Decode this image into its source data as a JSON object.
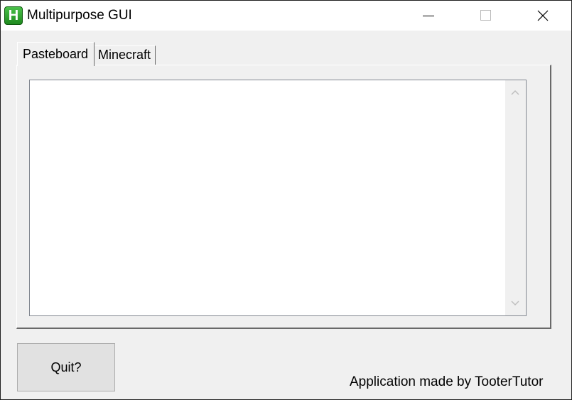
{
  "window": {
    "title": "Multipurpose GUI",
    "icon_letter": "H",
    "icon_color": "#2ca02c",
    "controls": [
      "minimize-icon",
      "maximize-icon",
      "close-icon"
    ]
  },
  "tabs": [
    {
      "label": "Pasteboard",
      "selected": true
    },
    {
      "label": "Minecraft",
      "selected": false
    }
  ],
  "pasteboard": {
    "text_value": ""
  },
  "footer": {
    "quit_label": "Quit?",
    "credit": "Application made by TooterTutor"
  }
}
